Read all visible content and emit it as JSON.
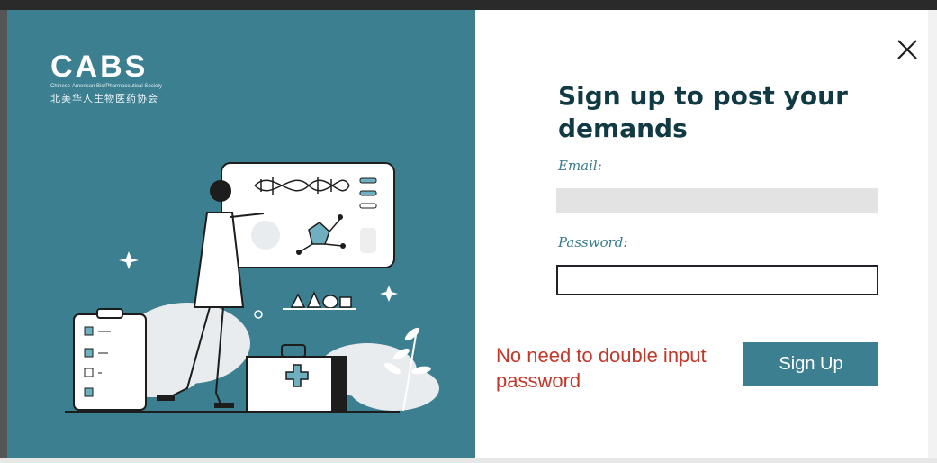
{
  "colors": {
    "panel": "#3c7f90",
    "heading": "#123a44",
    "label": "#3d7c8e",
    "hint": "#c0392b",
    "button": "#3c7f90"
  },
  "brand": {
    "logo": "CABS",
    "subtitle": "Chinese-American Bio/Pharmaceutical Society",
    "chinese_name": "北美华人生物医药协会"
  },
  "form": {
    "heading": "Sign up to post your demands",
    "email_label": "Email:",
    "email_value": "",
    "password_label": "Password:",
    "password_value": "",
    "hint": "No need to double input password",
    "submit_label": "Sign Up"
  },
  "icons": {
    "close": "close-icon"
  }
}
